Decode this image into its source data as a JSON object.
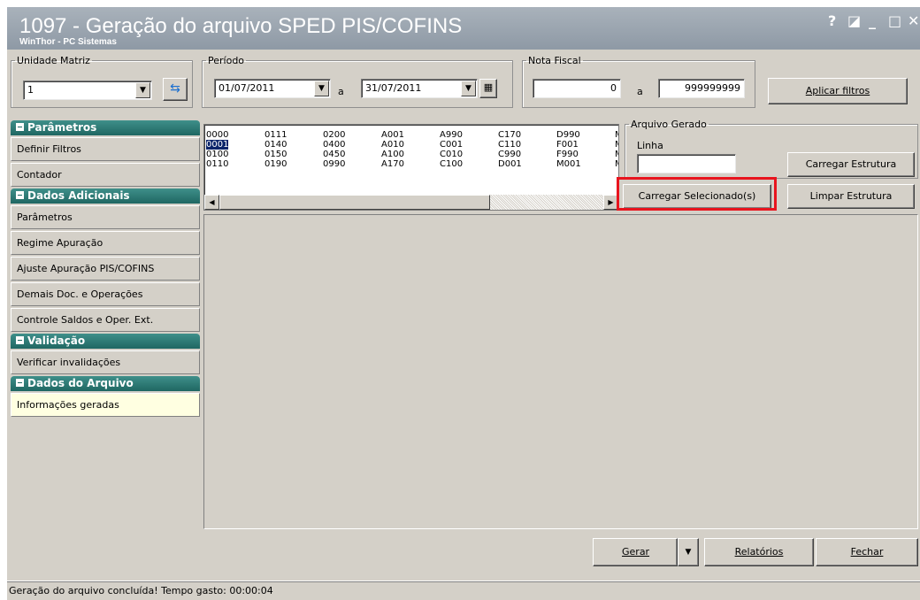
{
  "window": {
    "title": "1097 - Geração do arquivo SPED PIS/COFINS",
    "subtitle": "WinThor - PC Sistemas",
    "controls": [
      "?",
      "◪",
      "_",
      "□",
      "✕"
    ]
  },
  "filters": {
    "unidade_label": "Unidade Matriz",
    "unidade_value": "1",
    "periodo_label": "Período",
    "periodo_from": "01/07/2011",
    "periodo_sep": "a",
    "periodo_to": "31/07/2011",
    "nf_label": "Nota Fiscal",
    "nf_from": "0",
    "nf_sep": "a",
    "nf_to": "999999999",
    "apply_button": "Aplicar filtros"
  },
  "sidebar": {
    "sections": [
      {
        "header": "Parâmetros",
        "items": [
          "Definir Filtros",
          "Contador"
        ]
      },
      {
        "header": "Dados Adicionais",
        "items": [
          "Parâmetros",
          "Regime Apuração",
          "Ajuste Apuração PIS/COFINS",
          "Demais Doc. e Operações",
          "Controle Saldos e Oper. Ext."
        ]
      },
      {
        "header": "Validação",
        "items": [
          "Verificar invalidações"
        ]
      },
      {
        "header": "Dados do Arquivo",
        "items": [
          "Informações geradas"
        ]
      }
    ]
  },
  "registers": {
    "columns": [
      [
        "0000",
        "0001",
        "0100",
        "0110"
      ],
      [
        "0111",
        "0140",
        "0150",
        "0190"
      ],
      [
        "0200",
        "0400",
        "0450",
        "0990"
      ],
      [
        "A001",
        "A010",
        "A100",
        "A170"
      ],
      [
        "A990",
        "C001",
        "C010",
        "C100"
      ],
      [
        "C170",
        "C110",
        "C990",
        "D001"
      ],
      [
        "D990",
        "F001",
        "F990",
        "M001"
      ],
      [
        "M",
        "M",
        "M",
        "M"
      ]
    ],
    "selected": "0001"
  },
  "arquivo": {
    "group_label": "Arquivo Gerado",
    "linha_label": "Linha",
    "linha_value": "",
    "load_structure": "Carregar Estrutura",
    "load_selected": "Carregar Selecionado(s)",
    "clear_structure": "Limpar Estrutura"
  },
  "bottom_buttons": {
    "generate": "Gerar",
    "reports": "Relatórios",
    "close": "Fechar"
  },
  "status": "Geração do arquivo concluída! Tempo gasto: 00:00:04",
  "colors": {
    "section_header": "#1f6762",
    "active_item": "#ffffe1",
    "highlight": "#e8141e",
    "selection": "#0a246a"
  }
}
